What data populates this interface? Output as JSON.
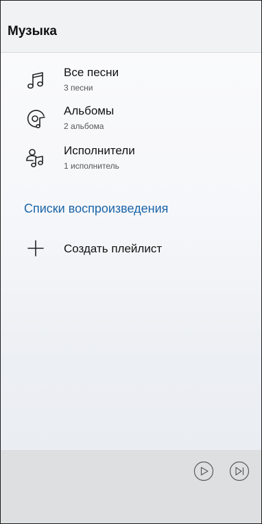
{
  "header": {
    "title": "Музыка"
  },
  "library": {
    "items": [
      {
        "icon": "music-note-icon",
        "label": "Все песни",
        "count": "3 песни"
      },
      {
        "icon": "album-icon",
        "label": "Альбомы",
        "count": "2 альбома"
      },
      {
        "icon": "artist-icon",
        "label": "Исполнители",
        "count": "1 исполнитель"
      }
    ]
  },
  "playlists": {
    "section_title": "Списки воспроизведения",
    "create_label": "Создать плейлист"
  },
  "player": {
    "controls": [
      "play-icon",
      "next-track-icon"
    ]
  },
  "colors": {
    "accent": "#1a64a8",
    "player_bar": "#dedfe0",
    "header_bg": "#f1f2f4"
  }
}
